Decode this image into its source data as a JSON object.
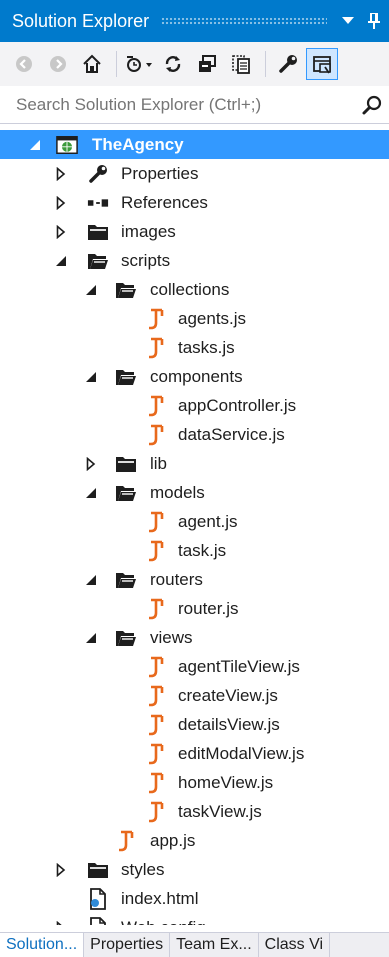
{
  "window": {
    "title": "Solution Explorer"
  },
  "search": {
    "placeholder": "Search Solution Explorer (Ctrl+;)"
  },
  "toolbar": {
    "buttons": [
      "back-icon",
      "forward-icon",
      "home-icon",
      "sync-icon",
      "refresh-icon",
      "collapse-all-icon",
      "show-all-files-icon",
      "properties-icon",
      "preview-icon"
    ]
  },
  "tree": {
    "items": [
      {
        "label": "TheAgency",
        "depth": 0,
        "expander": "expanded",
        "icon": "project-icon",
        "selected": true
      },
      {
        "label": "Properties",
        "depth": 1,
        "expander": "collapsed",
        "icon": "wrench-icon"
      },
      {
        "label": "References",
        "depth": 1,
        "expander": "collapsed",
        "icon": "references-icon"
      },
      {
        "label": "images",
        "depth": 1,
        "expander": "collapsed",
        "icon": "folder-icon"
      },
      {
        "label": "scripts",
        "depth": 1,
        "expander": "expanded",
        "icon": "folder-open-icon"
      },
      {
        "label": "collections",
        "depth": 2,
        "expander": "expanded",
        "icon": "folder-open-icon"
      },
      {
        "label": "agents.js",
        "depth": 3,
        "expander": "none",
        "icon": "js-file-icon"
      },
      {
        "label": "tasks.js",
        "depth": 3,
        "expander": "none",
        "icon": "js-file-icon"
      },
      {
        "label": "components",
        "depth": 2,
        "expander": "expanded",
        "icon": "folder-open-icon"
      },
      {
        "label": "appController.js",
        "depth": 3,
        "expander": "none",
        "icon": "js-file-icon"
      },
      {
        "label": "dataService.js",
        "depth": 3,
        "expander": "none",
        "icon": "js-file-icon"
      },
      {
        "label": "lib",
        "depth": 2,
        "expander": "collapsed",
        "icon": "folder-icon"
      },
      {
        "label": "models",
        "depth": 2,
        "expander": "expanded",
        "icon": "folder-open-icon"
      },
      {
        "label": "agent.js",
        "depth": 3,
        "expander": "none",
        "icon": "js-file-icon"
      },
      {
        "label": "task.js",
        "depth": 3,
        "expander": "none",
        "icon": "js-file-icon"
      },
      {
        "label": "routers",
        "depth": 2,
        "expander": "expanded",
        "icon": "folder-open-icon"
      },
      {
        "label": "router.js",
        "depth": 3,
        "expander": "none",
        "icon": "js-file-icon"
      },
      {
        "label": "views",
        "depth": 2,
        "expander": "expanded",
        "icon": "folder-open-icon"
      },
      {
        "label": "agentTileView.js",
        "depth": 3,
        "expander": "none",
        "icon": "js-file-icon"
      },
      {
        "label": "createView.js",
        "depth": 3,
        "expander": "none",
        "icon": "js-file-icon"
      },
      {
        "label": "detailsView.js",
        "depth": 3,
        "expander": "none",
        "icon": "js-file-icon"
      },
      {
        "label": "editModalView.js",
        "depth": 3,
        "expander": "none",
        "icon": "js-file-icon"
      },
      {
        "label": "homeView.js",
        "depth": 3,
        "expander": "none",
        "icon": "js-file-icon"
      },
      {
        "label": "taskView.js",
        "depth": 3,
        "expander": "none",
        "icon": "js-file-icon"
      },
      {
        "label": "app.js",
        "depth": 2,
        "expander": "none",
        "icon": "js-file-icon"
      },
      {
        "label": "styles",
        "depth": 1,
        "expander": "collapsed",
        "icon": "folder-icon"
      },
      {
        "label": "index.html",
        "depth": 1,
        "expander": "none",
        "icon": "html-file-icon"
      },
      {
        "label": "Web.config",
        "depth": 1,
        "expander": "collapsed",
        "icon": "config-file-icon"
      }
    ]
  },
  "tabs": [
    {
      "label": "Solution...",
      "active": true
    },
    {
      "label": "Properties",
      "active": false
    },
    {
      "label": "Team Ex...",
      "active": false
    },
    {
      "label": "Class Vi",
      "active": false
    }
  ],
  "colors": {
    "accent": "#007acc",
    "selection": "#3399ff",
    "js_icon": "#e8691c"
  }
}
